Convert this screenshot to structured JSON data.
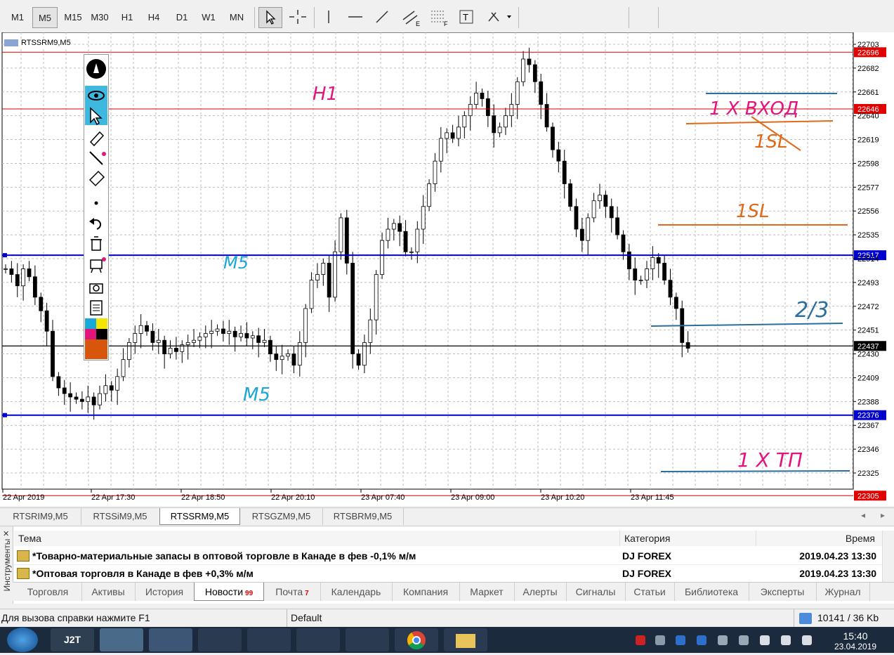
{
  "timeframes": [
    "M1",
    "M5",
    "M15",
    "M30",
    "H1",
    "H4",
    "D1",
    "W1",
    "MN"
  ],
  "active_timeframe": "M5",
  "chart": {
    "title": "RTSSRM9,M5",
    "price_labels": [
      "22703",
      "22682",
      "22661",
      "22640",
      "22619",
      "22598",
      "22577",
      "22556",
      "22535",
      "22514",
      "22493",
      "22472",
      "22451",
      "22430",
      "22409",
      "22388",
      "22367",
      "22346",
      "22325"
    ],
    "red_level_labels": [
      "22696",
      "22646",
      "22305"
    ],
    "blue_level_labels": [
      "22517",
      "22376"
    ],
    "current_price": "22437",
    "time_labels": [
      "22 Apr 2019",
      "22 Apr 17:30",
      "22 Apr 18:50",
      "22 Apr 20:10",
      "23 Apr 07:40",
      "23 Apr 09:00",
      "23 Apr 10:20",
      "23 Apr 11:45"
    ],
    "annotations": {
      "h1": "H1",
      "m5_top": "M5",
      "m5_bottom": "M5",
      "entry": "1 X ВХОД",
      "sl_struck": "1SL",
      "sl": "1SL",
      "two_thirds": "2/3",
      "tp": "1 X ТП"
    },
    "colors": {
      "red_level": "#e00000",
      "blue_level": "#0000cc",
      "pink": "#e3157c",
      "cyan": "#1aa6d6",
      "orange": "#e06a1a",
      "steel_blue": "#2a6f9e",
      "bull": "#ffffff",
      "bear": "#000000"
    }
  },
  "symbol_tabs": [
    "RTSRIM9,M5",
    "RTSSiM9,M5",
    "RTSSRM9,M5",
    "RTSGZM9,M5",
    "RTSBRM9,M5"
  ],
  "active_symbol_tab": "RTSSRM9,M5",
  "terminal": {
    "side_label": "Инструменты",
    "columns": {
      "topic": "Тема",
      "category": "Категория",
      "time": "Время"
    },
    "rows": [
      {
        "topic": "*Товарно-материальные запасы в оптовой торговле в Канаде в фев -0,1% м/м",
        "category": "DJ FOREX",
        "time": "2019.04.23 13:30"
      },
      {
        "topic": "*Оптовая торговля в Канаде в фев +0,3% м/м",
        "category": "DJ FOREX",
        "time": "2019.04.23 13:30"
      }
    ],
    "tabs": [
      {
        "label": "Торговля",
        "badge": ""
      },
      {
        "label": "Активы",
        "badge": ""
      },
      {
        "label": "История",
        "badge": ""
      },
      {
        "label": "Новости",
        "badge": "99"
      },
      {
        "label": "Почта",
        "badge": "7"
      },
      {
        "label": "Календарь",
        "badge": ""
      },
      {
        "label": "Компания",
        "badge": ""
      },
      {
        "label": "Маркет",
        "badge": ""
      },
      {
        "label": "Алерты",
        "badge": ""
      },
      {
        "label": "Сигналы",
        "badge": ""
      },
      {
        "label": "Статьи",
        "badge": ""
      },
      {
        "label": "Библиотека",
        "badge": ""
      },
      {
        "label": "Эксперты",
        "badge": ""
      },
      {
        "label": "Журнал",
        "badge": ""
      }
    ]
  },
  "status": {
    "help": "Для вызова справки нажмите F1",
    "profile": "Default",
    "traffic": "10141 / 36 Kb"
  },
  "taskbar": {
    "time": "15:40",
    "date": "23.04.2019",
    "j2t": "J2T"
  }
}
